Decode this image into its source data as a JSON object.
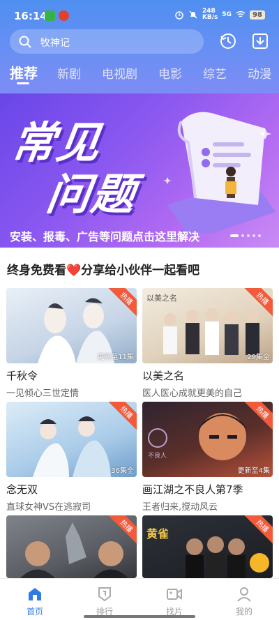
{
  "status_bar": {
    "time": "16:14",
    "network_speed": "248\nKB/s",
    "signal": "5G",
    "battery": "98"
  },
  "search": {
    "query": "牧神记",
    "search_icon": "search-icon",
    "history_icon": "history-icon",
    "download_icon": "download-icon"
  },
  "tabs": [
    {
      "label": "推荐",
      "active": true
    },
    {
      "label": "新剧"
    },
    {
      "label": "电视剧"
    },
    {
      "label": "电影"
    },
    {
      "label": "综艺"
    },
    {
      "label": "动漫"
    }
  ],
  "banner": {
    "title_line1": "常见",
    "title_line2": "问题",
    "caption": "安装、报毒、广告等问题点击这里解决"
  },
  "section": {
    "title": "终身免费看❤️分享给小伙伴一起看吧"
  },
  "cards": [
    {
      "title": "千秋令",
      "subtitle": "一见倾心三世定情",
      "badge": "热播",
      "episodes": "更新至11集",
      "color1": "#dfe8f2",
      "color2": "#a9bfd6"
    },
    {
      "title": "以美之名",
      "subtitle": "医人医心成就更美的自己",
      "badge": "热播",
      "episodes": "29集全",
      "color1": "#efe6d8",
      "color2": "#c9b59a"
    },
    {
      "title": "念无双",
      "subtitle": "直球女神VS在逃寂司",
      "badge": "热播",
      "episodes": "36集全",
      "color1": "#cfe3f3",
      "color2": "#8fb6db"
    },
    {
      "title": "画江湖之不良人第7季",
      "subtitle": "王者归来,搅动风云",
      "badge": "热播",
      "episodes": "更新至4集",
      "color1": "#3b2a35",
      "color2": "#c2573e"
    },
    {
      "title": "",
      "subtitle": "",
      "badge": "热播",
      "episodes": "",
      "color1": "#6d7075",
      "color2": "#3c3f44"
    },
    {
      "title": "",
      "subtitle": "",
      "badge": "热播",
      "episodes": "",
      "color1": "#2d3038",
      "color2": "#16181d"
    }
  ],
  "bottom_nav": [
    {
      "label": "首页",
      "icon": "home-icon",
      "active": true
    },
    {
      "label": "排行",
      "icon": "ranking-icon"
    },
    {
      "label": "找片",
      "icon": "video-camera-icon"
    },
    {
      "label": "我的",
      "icon": "profile-icon"
    }
  ],
  "colors": {
    "accent": "#2f7be8",
    "badge": "#f25a3a",
    "header": "#5b8ff2"
  }
}
